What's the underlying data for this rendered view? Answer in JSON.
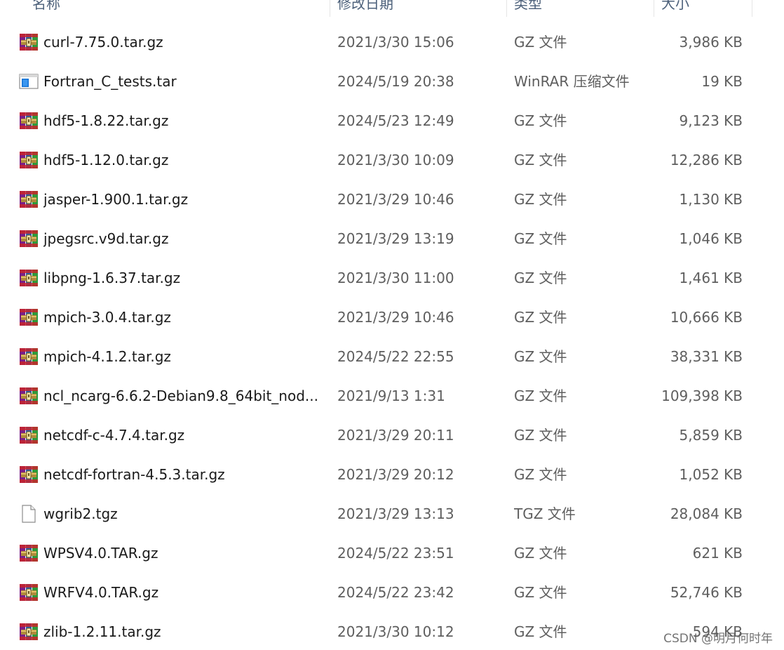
{
  "columns": {
    "name": "名称",
    "date": "修改日期",
    "type": "类型",
    "size": "大小"
  },
  "files": [
    {
      "name": "curl-7.75.0.tar.gz",
      "date": "2021/3/30 15:06",
      "type": "GZ 文件",
      "size": "3,986 KB",
      "icon": "winrar-archive-icon"
    },
    {
      "name": "Fortran_C_tests.tar",
      "date": "2024/5/19 20:38",
      "type": "WinRAR 压缩文件",
      "size": "19 KB",
      "icon": "tar-archive-icon"
    },
    {
      "name": "hdf5-1.8.22.tar.gz",
      "date": "2024/5/23 12:49",
      "type": "GZ 文件",
      "size": "9,123 KB",
      "icon": "winrar-archive-icon"
    },
    {
      "name": "hdf5-1.12.0.tar.gz",
      "date": "2021/3/30 10:09",
      "type": "GZ 文件",
      "size": "12,286 KB",
      "icon": "winrar-archive-icon"
    },
    {
      "name": "jasper-1.900.1.tar.gz",
      "date": "2021/3/29 10:46",
      "type": "GZ 文件",
      "size": "1,130 KB",
      "icon": "winrar-archive-icon"
    },
    {
      "name": "jpegsrc.v9d.tar.gz",
      "date": "2021/3/29 13:19",
      "type": "GZ 文件",
      "size": "1,046 KB",
      "icon": "winrar-archive-icon"
    },
    {
      "name": "libpng-1.6.37.tar.gz",
      "date": "2021/3/30 11:00",
      "type": "GZ 文件",
      "size": "1,461 KB",
      "icon": "winrar-archive-icon"
    },
    {
      "name": "mpich-3.0.4.tar.gz",
      "date": "2021/3/29 10:46",
      "type": "GZ 文件",
      "size": "10,666 KB",
      "icon": "winrar-archive-icon"
    },
    {
      "name": "mpich-4.1.2.tar.gz",
      "date": "2024/5/22 22:55",
      "type": "GZ 文件",
      "size": "38,331 KB",
      "icon": "winrar-archive-icon"
    },
    {
      "name": "ncl_ncarg-6.6.2-Debian9.8_64bit_nod...",
      "date": "2021/9/13 1:31",
      "type": "GZ 文件",
      "size": "109,398 KB",
      "icon": "winrar-archive-icon"
    },
    {
      "name": "netcdf-c-4.7.4.tar.gz",
      "date": "2021/3/29 20:11",
      "type": "GZ 文件",
      "size": "5,859 KB",
      "icon": "winrar-archive-icon"
    },
    {
      "name": "netcdf-fortran-4.5.3.tar.gz",
      "date": "2021/3/29 20:12",
      "type": "GZ 文件",
      "size": "1,052 KB",
      "icon": "winrar-archive-icon"
    },
    {
      "name": "wgrib2.tgz",
      "date": "2021/3/29 13:13",
      "type": "TGZ 文件",
      "size": "28,084 KB",
      "icon": "blank-file-icon"
    },
    {
      "name": "WPSV4.0.TAR.gz",
      "date": "2024/5/22 23:51",
      "type": "GZ 文件",
      "size": "621 KB",
      "icon": "winrar-archive-icon"
    },
    {
      "name": "WRFV4.0.TAR.gz",
      "date": "2024/5/22 23:42",
      "type": "GZ 文件",
      "size": "52,746 KB",
      "icon": "winrar-archive-icon"
    },
    {
      "name": "zlib-1.2.11.tar.gz",
      "date": "2021/3/30 10:12",
      "type": "GZ 文件",
      "size": "594 KB",
      "icon": "winrar-archive-icon"
    }
  ],
  "watermark": "CSDN @明月何时年"
}
